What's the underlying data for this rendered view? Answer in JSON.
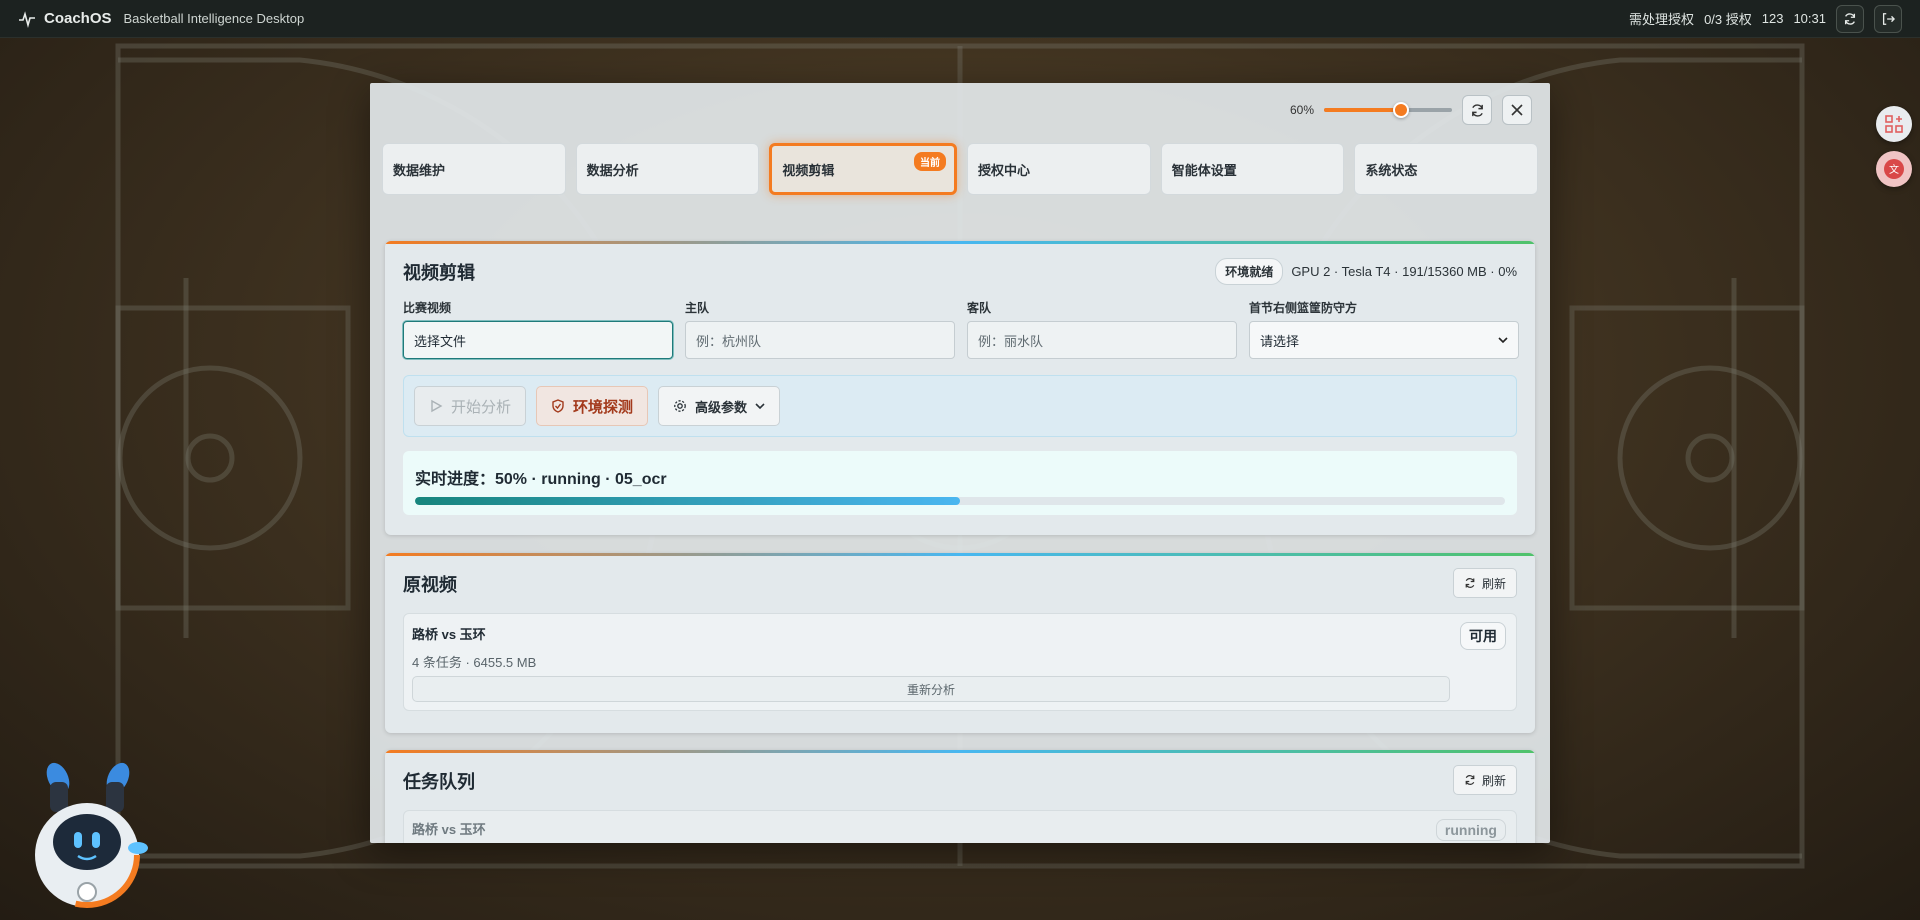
{
  "topbar": {
    "brand": "CoachOS",
    "subtitle": "Basketball Intelligence Desktop",
    "pending_auth": "需处理授权",
    "auth_count": "0/3 授权",
    "user": "123",
    "time": "10:31"
  },
  "modal": {
    "zoom_label": "60%",
    "zoom_value": 0.6,
    "tabs": [
      {
        "label": "数据维护"
      },
      {
        "label": "数据分析"
      },
      {
        "label": "视频剪辑",
        "badge": "当前"
      },
      {
        "label": "授权中心"
      },
      {
        "label": "智能体设置"
      },
      {
        "label": "系统状态"
      }
    ]
  },
  "editor": {
    "title": "视频剪辑",
    "env_badge": "环境就绪",
    "gpu_info": "GPU 2 · Tesla T4 · 191/15360 MB · 0%",
    "fields": {
      "video_label": "比赛视频",
      "video_value": "选择文件",
      "home_label": "主队",
      "home_placeholder": "例：杭州队",
      "away_label": "客队",
      "away_placeholder": "例：丽水队",
      "defense_label": "首节右侧篮筐防守方",
      "defense_value": "请选择"
    },
    "start_button": "开始分析",
    "env_button": "环境探测",
    "advanced_button": "高级参数",
    "progress_text": "实时进度：50% · running · 05_ocr",
    "progress_value": 0.5
  },
  "originals": {
    "title": "原视频",
    "refresh": "刷新",
    "card": {
      "title": "路桥 vs 玉环",
      "meta": "4 条任务 · 6455.5 MB",
      "status": "可用",
      "action": "重新分析"
    }
  },
  "queue": {
    "title": "任务队列",
    "refresh": "刷新",
    "row": {
      "title": "路桥 vs 玉环",
      "status": "running"
    }
  },
  "colors": {
    "accent": "#f47b20",
    "teal": "#17857d",
    "blue": "#4ab6f0",
    "green": "#4fc26a"
  }
}
